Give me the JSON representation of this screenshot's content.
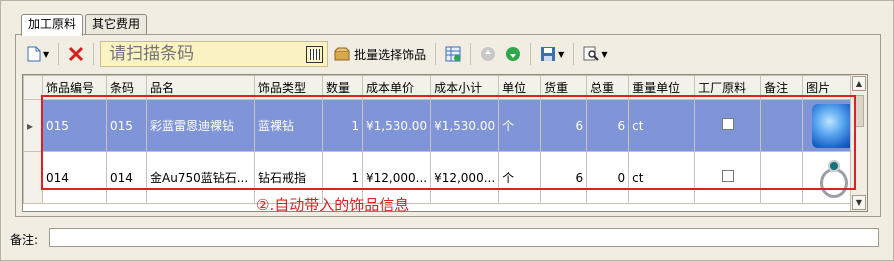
{
  "tabs": [
    {
      "label": "加工原料",
      "active": true
    },
    {
      "label": "其它费用",
      "active": false
    }
  ],
  "toolbar": {
    "scan_placeholder": "请扫描条码",
    "batch_select_label": "批量选择饰品"
  },
  "grid": {
    "columns": [
      "饰品编号",
      "条码",
      "品名",
      "饰品类型",
      "数量",
      "成本单价",
      "成本小计",
      "单位",
      "货重",
      "总重",
      "重量单位",
      "工厂原料",
      "备注",
      "图片"
    ],
    "rows": [
      {
        "code": "015",
        "barcode": "015",
        "name": "彩蓝雷恩迪裸钻",
        "type": "蓝裸钻",
        "qty": "1",
        "unit_cost": "¥1,530.00",
        "subtotal": "¥1,530.00",
        "unit": "个",
        "goods_weight": "6",
        "total_weight": "6",
        "weight_unit": "ct",
        "factory_material": false,
        "remark": "",
        "image": "blue-gem-image",
        "selected": true
      },
      {
        "code": "014",
        "barcode": "014",
        "name": "金Au750蓝钻石...",
        "type": "钻石戒指",
        "qty": "1",
        "unit_cost": "¥12,000...",
        "subtotal": "¥12,000...",
        "unit": "个",
        "goods_weight": "6",
        "total_weight": "0",
        "weight_unit": "ct",
        "factory_material": false,
        "remark": "",
        "image": "ring-image",
        "selected": false
      }
    ]
  },
  "annotation": "②.自动带入的饰品信息",
  "remark": {
    "label": "备注:",
    "value": ""
  },
  "colors": {
    "selected_row": "#7f95d8",
    "highlight": "#e02020",
    "scan_box": "#fbf3c2"
  }
}
